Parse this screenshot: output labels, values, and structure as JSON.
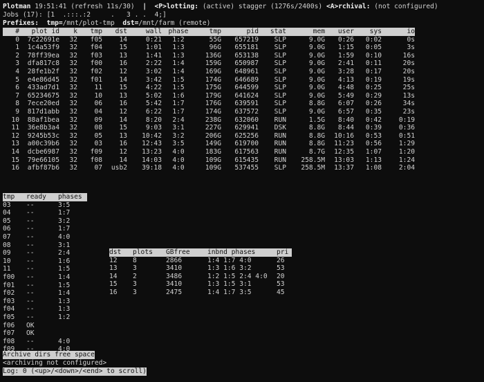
{
  "header": {
    "app": "Plotman",
    "time": "19:51:41",
    "refresh": "(refresh 11s/30)",
    "sep": "|",
    "plotting_key": "<P>lotting:",
    "plotting_status": "(active) stagger (1276s/2400s)",
    "archival_key": "<A>rchival:",
    "archival_status": "(not configured)"
  },
  "jobs_line": "Jobs (17): [1  .:::.:2     .   3 . .  4;]",
  "prefixes": {
    "label": "Prefixes:",
    "tmp_key": "tmp=",
    "tmp_value": "/mnt/plot-tmp",
    "dst_key": "dst=",
    "dst_value": "/mnt/farm (remote)"
  },
  "jobs_table": {
    "columns": [
      "#",
      "plot id",
      "k",
      "tmp",
      "dst",
      "wall",
      "phase",
      "tmp",
      "pid",
      "stat",
      "mem",
      "user",
      "sys",
      "io"
    ],
    "rows": [
      [
        "0",
        "7c22691e",
        "32",
        "f05",
        "14",
        "0:21",
        "1:2",
        "55G",
        "657219",
        "SLP",
        "9.0G",
        "0:26",
        "0:02",
        "0s"
      ],
      [
        "1",
        "1c4a53f9",
        "32",
        "f04",
        "15",
        "1:01",
        "1:3",
        "96G",
        "655181",
        "SLP",
        "9.0G",
        "1:15",
        "0:05",
        "3s"
      ],
      [
        "2",
        "78ff39ea",
        "32",
        "f03",
        "13",
        "1:41",
        "1:3",
        "136G",
        "653138",
        "SLP",
        "9.0G",
        "1:59",
        "0:10",
        "16s"
      ],
      [
        "3",
        "dfa817c8",
        "32",
        "f00",
        "16",
        "2:22",
        "1:4",
        "159G",
        "650987",
        "SLP",
        "9.0G",
        "2:41",
        "0:11",
        "20s"
      ],
      [
        "4",
        "28fe1b2f",
        "32",
        "f02",
        "12",
        "3:02",
        "1:4",
        "169G",
        "648961",
        "SLP",
        "9.0G",
        "3:28",
        "0:17",
        "20s"
      ],
      [
        "5",
        "e4e86d45",
        "32",
        "f01",
        "14",
        "3:42",
        "1:5",
        "174G",
        "646689",
        "SLP",
        "9.0G",
        "4:13",
        "0:19",
        "19s"
      ],
      [
        "6",
        "433ad7d1",
        "32",
        "11",
        "15",
        "4:22",
        "1:5",
        "175G",
        "644599",
        "SLP",
        "9.0G",
        "4:48",
        "0:25",
        "25s"
      ],
      [
        "7",
        "65234675",
        "32",
        "10",
        "13",
        "5:02",
        "1:6",
        "179G",
        "641624",
        "SLP",
        "9.0G",
        "5:49",
        "0:29",
        "13s"
      ],
      [
        "8",
        "7ece20ed",
        "32",
        "06",
        "16",
        "5:42",
        "1:7",
        "176G",
        "639591",
        "SLP",
        "8.8G",
        "6:07",
        "0:26",
        "34s"
      ],
      [
        "9",
        "817d1abb",
        "32",
        "04",
        "12",
        "6:22",
        "1:7",
        "174G",
        "637572",
        "SLP",
        "9.0G",
        "6:57",
        "0:35",
        "23s"
      ],
      [
        "10",
        "88af1bea",
        "32",
        "09",
        "14",
        "8:20",
        "2:4",
        "238G",
        "632060",
        "RUN",
        "1.5G",
        "8:40",
        "0:42",
        "0:19"
      ],
      [
        "11",
        "36e8b3a4",
        "32",
        "08",
        "15",
        "9:03",
        "3:1",
        "227G",
        "629941",
        "DSK",
        "8.8G",
        "8:44",
        "0:39",
        "0:36"
      ],
      [
        "12",
        "9245b53c",
        "32",
        "05",
        "13",
        "10:42",
        "3:2",
        "206G",
        "625256",
        "RUN",
        "8.8G",
        "10:16",
        "0:53",
        "0:51"
      ],
      [
        "13",
        "a00c39b6",
        "32",
        "03",
        "16",
        "12:43",
        "3:5",
        "149G",
        "619700",
        "RUN",
        "8.8G",
        "11:23",
        "0:56",
        "1:29"
      ],
      [
        "14",
        "dcbe6987",
        "32",
        "f09",
        "12",
        "13:23",
        "4:0",
        "183G",
        "617563",
        "RUN",
        "8.7G",
        "12:35",
        "1:07",
        "1:20"
      ],
      [
        "15",
        "79e66105",
        "32",
        "f08",
        "14",
        "14:03",
        "4:0",
        "109G",
        "615435",
        "RUN",
        "258.5M",
        "13:03",
        "1:13",
        "1:24"
      ],
      [
        "16",
        "afbf87b6",
        "32",
        "07",
        "usb2",
        "39:18",
        "4:0",
        "109G",
        "537455",
        "SLP",
        "258.5M",
        "13:37",
        "1:08",
        "2:04"
      ]
    ]
  },
  "tmp_table": {
    "columns": [
      "tmp",
      "ready",
      "phases"
    ],
    "rows": [
      [
        "03",
        "--",
        "3:5"
      ],
      [
        "04",
        "--",
        "1:7"
      ],
      [
        "05",
        "--",
        "3:2"
      ],
      [
        "06",
        "--",
        "1:7"
      ],
      [
        "07",
        "--",
        "4:0"
      ],
      [
        "08",
        "--",
        "3:1"
      ],
      [
        "09",
        "--",
        "2:4"
      ],
      [
        "10",
        "--",
        "1:6"
      ],
      [
        "11",
        "--",
        "1:5"
      ],
      [
        "f00",
        "--",
        "1:4"
      ],
      [
        "f01",
        "--",
        "1:5"
      ],
      [
        "f02",
        "--",
        "1:4"
      ],
      [
        "f03",
        "--",
        "1:3"
      ],
      [
        "f04",
        "--",
        "1:3"
      ],
      [
        "f05",
        "--",
        "1:2"
      ],
      [
        "f06",
        "OK",
        ""
      ],
      [
        "f07",
        "OK",
        ""
      ],
      [
        "f08",
        "--",
        "4:0"
      ],
      [
        "f09",
        "--",
        "4:0"
      ]
    ]
  },
  "dst_table": {
    "columns": [
      "dst",
      "plots",
      "GBfree",
      "inbnd phases",
      "pri"
    ],
    "rows": [
      [
        "12",
        "8",
        "2866",
        "1:4 1:7 4:0",
        "26"
      ],
      [
        "13",
        "3",
        "3410",
        "1:3 1:6 3:2",
        "53"
      ],
      [
        "14",
        "2",
        "3486",
        "1:2 1:5 2:4 4:0",
        "20"
      ],
      [
        "15",
        "3",
        "3410",
        "1:3 1:5 3:1",
        "53"
      ],
      [
        "16",
        "3",
        "2475",
        "1:4 1:7 3:5",
        "45"
      ]
    ]
  },
  "archive": {
    "header": "Archive dirs free space",
    "status": "<archiving not configured>"
  },
  "log_bar": "Log: 0 (<up>/<down>/<end> to scroll)",
  "colors": {
    "background": "#0d0d0d",
    "text": "#d2d2d2",
    "highlight_bg": "#cfcfcf",
    "highlight_text": "#111111"
  }
}
